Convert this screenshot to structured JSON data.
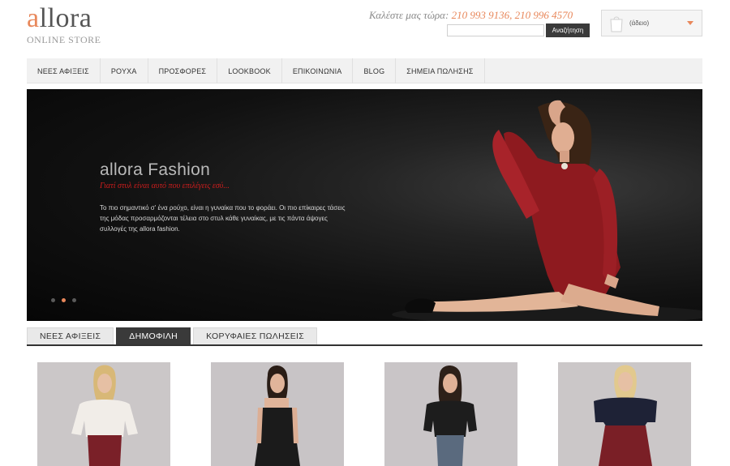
{
  "brand": {
    "logo_first": "a",
    "logo_rest": "llora",
    "tagline": "ONLINE STORE",
    "accent": "#e8875a"
  },
  "header": {
    "phone_label": "Καλέστε μας τώρα:",
    "phone_numbers": "210 993 9136, 210 996 4570",
    "search_placeholder": "",
    "search_button": "Αναζήτηση",
    "cart_label": "(άδειο)"
  },
  "nav": {
    "items": [
      {
        "label": "ΝΕΕΣ ΑΦΙΞΕΙΣ"
      },
      {
        "label": "ΡΟΥΧΑ"
      },
      {
        "label": "ΠΡΟΣΦΟΡΕΣ"
      },
      {
        "label": "LOOKBOOK"
      },
      {
        "label": "ΕΠΙΚΟΙΝΩΝΙΑ"
      },
      {
        "label": "BLOG"
      },
      {
        "label": "ΣΗΜΕΙΑ ΠΩΛΗΣΗΣ"
      }
    ]
  },
  "hero": {
    "title": "allora Fashion",
    "subtitle": "Γιατί στυλ είναι αυτό που επιλέγεις εσύ...",
    "text": "Το πιο σημαντικό σ' ένα ρούχο, είναι η γυναίκα που το φοράει. Οι πιο επίκαιρες τάσεις της μόδας προσαρμόζονται τέλεια στο στυλ κάθε γυναίκας, με τις πάντα άψογες συλλογές της allora fashion.",
    "slide_count": 3,
    "active_slide": 2,
    "dress_color": "#8e1a1f"
  },
  "tabs": {
    "items": [
      {
        "label": "ΝΕΕΣ ΑΦΙΞΕΙΣ",
        "active": false
      },
      {
        "label": "ΔΗΜΟΦΙΛΗ",
        "active": true
      },
      {
        "label": "ΚΟΡΥΦΑΙΕΣ ΠΩΛΗΣΕΙΣ",
        "active": false
      }
    ]
  },
  "products": [
    {
      "name": "white-blouse-burgundy-pants",
      "top_color": "#f1ede8",
      "bottom_color": "#7a2028",
      "hair_color": "#d8b877"
    },
    {
      "name": "black-slip-dress",
      "top_color": "#1b1b1b",
      "bottom_color": "#1b1b1b",
      "hair_color": "#2a1d16"
    },
    {
      "name": "black-off-shoulder-top-jeans",
      "top_color": "#1d1d1d",
      "bottom_color": "#5a6a7e",
      "hair_color": "#2d2019"
    },
    {
      "name": "navy-top-burgundy-trousers",
      "top_color": "#1e2236",
      "bottom_color": "#7a1f26",
      "hair_color": "#e2c98e"
    }
  ]
}
